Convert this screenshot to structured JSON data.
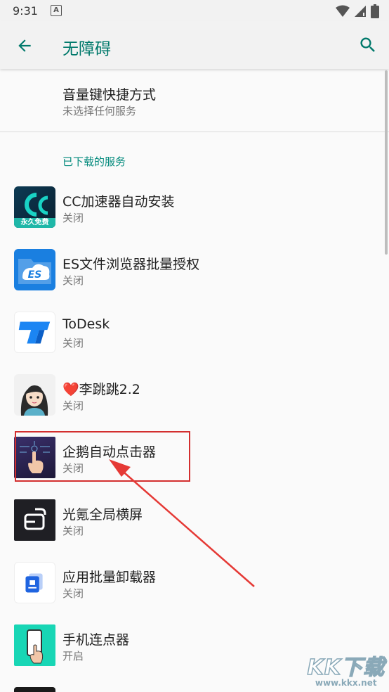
{
  "status_bar": {
    "time": "9:31",
    "notif_letter": "A"
  },
  "app_bar": {
    "title": "无障碍",
    "back_icon": "arrow-back-icon",
    "search_icon": "search-icon"
  },
  "shortcut": {
    "title": "音量键快捷方式",
    "subtitle": "未选择任何服务"
  },
  "category_title": "已下载的服务",
  "services": [
    {
      "name": "CC加速器自动安装",
      "status": "关闭",
      "icon": "cc-accelerator-icon",
      "icon_text": "永久免费"
    },
    {
      "name": "ES文件浏览器批量授权",
      "status": "关闭",
      "icon": "es-file-explorer-icon",
      "icon_text": "ES"
    },
    {
      "name": "ToDesk",
      "status": "关闭",
      "icon": "todesk-icon"
    },
    {
      "name": "❤️李跳跳2.2",
      "status": "关闭",
      "icon": "li-tiaotiao-avatar-icon"
    },
    {
      "name": "企鹅自动点击器",
      "status": "关闭",
      "icon": "penguin-autoclicker-icon"
    },
    {
      "name": "光氪全局横屏",
      "status": "关闭",
      "icon": "guangke-rotation-icon"
    },
    {
      "name": "应用批量卸载器",
      "status": "关闭",
      "icon": "batch-uninstaller-icon"
    },
    {
      "name": "手机连点器",
      "status": "开启",
      "icon": "phone-clicker-icon"
    }
  ],
  "watermark": {
    "logo": "KK下载",
    "url": "www.kkx.net"
  },
  "colors": {
    "accent": "#00796b",
    "category": "#00897b",
    "highlight": "#d32f2f"
  }
}
